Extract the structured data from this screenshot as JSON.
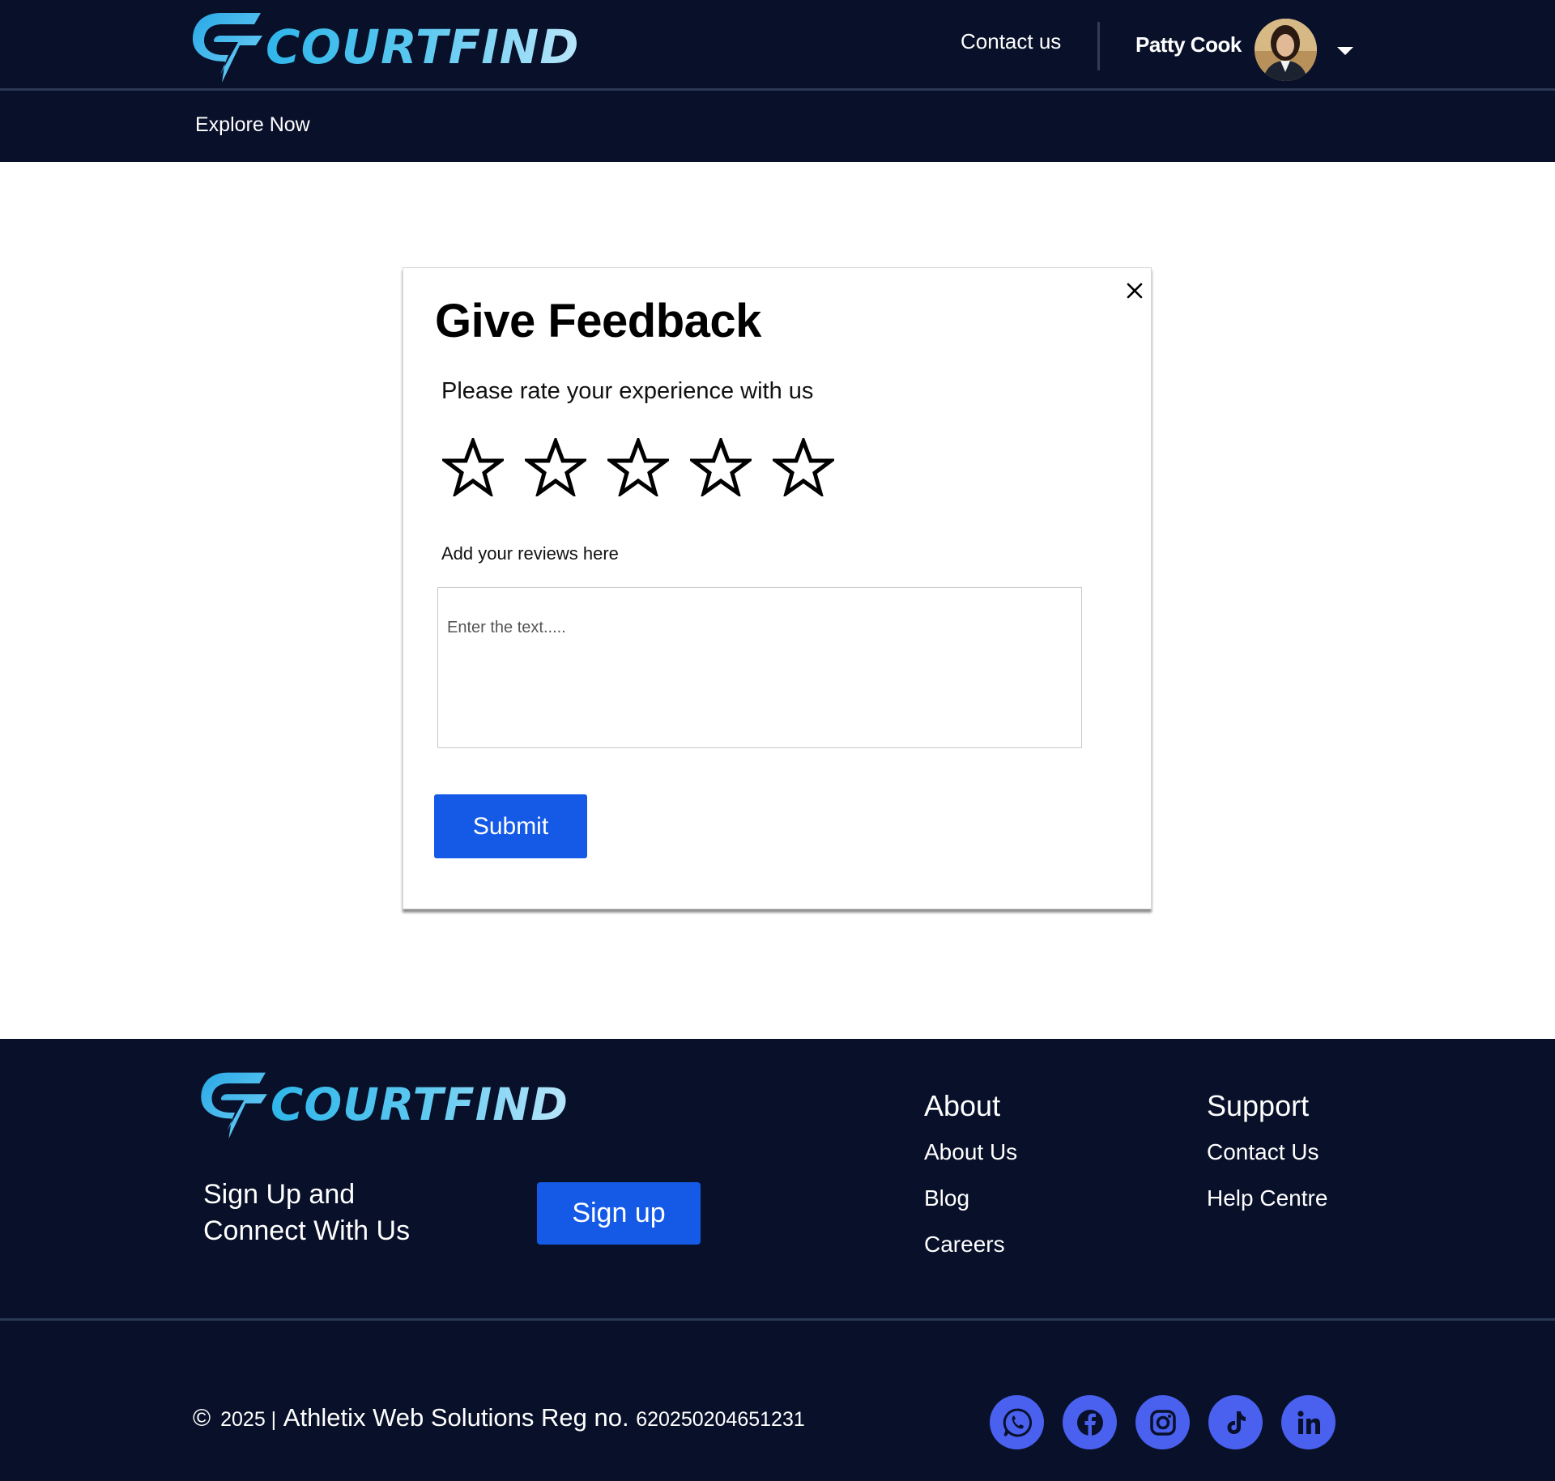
{
  "brand": {
    "name": "COURTFIND",
    "colors": {
      "dark_bg": "#08102a",
      "accent_blue": "#145ae6",
      "logo_cyan": "#2fb6ea",
      "social_blue": "#4a60ee"
    }
  },
  "header": {
    "contact_label": "Contact us",
    "user_name": "Patty Cook",
    "explore_label": "Explore Now",
    "icons": {
      "avatar": "user-avatar",
      "dropdown": "chevron-down-icon"
    }
  },
  "modal": {
    "title": "Give Feedback",
    "rate_label": "Please rate your experience with us",
    "rating": {
      "value": 0,
      "max": 5
    },
    "review_label": "Add your reviews here",
    "review_placeholder": "Enter the text.....",
    "submit_label": "Submit",
    "close_icon": "close-icon"
  },
  "footer": {
    "signup_line1": "Sign Up and",
    "signup_line2": "Connect With Us",
    "signup_button": "Sign up",
    "about": {
      "title": "About",
      "links": [
        "About Us",
        "Blog",
        "Careers"
      ]
    },
    "support": {
      "title": "Support",
      "links": [
        "Contact Us",
        "Help Centre"
      ]
    },
    "copyright_symbol": "©",
    "copyright_year": "2025 |",
    "copyright_company": "Athletix Web Solutions Reg no.",
    "copyright_reg": "620250204651231",
    "socials": [
      "whatsapp-icon",
      "facebook-icon",
      "instagram-icon",
      "tiktok-icon",
      "linkedin-icon"
    ]
  }
}
